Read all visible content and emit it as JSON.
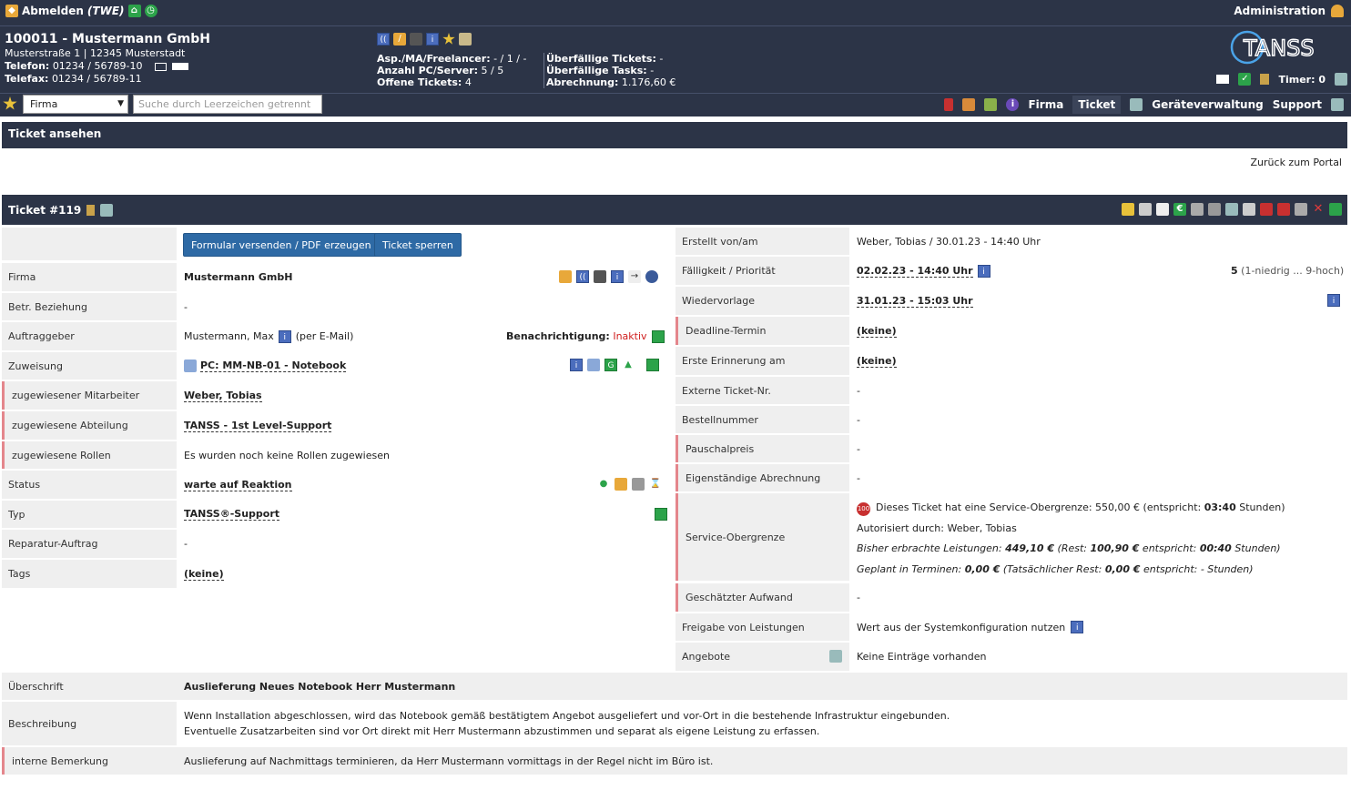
{
  "header": {
    "logout_label": "Abmelden",
    "user_code": "(TWE)",
    "admin_label": "Administration",
    "customer": {
      "title": "100011 - Mustermann GmbH",
      "address": "Musterstraße 1 | 12345 Musterstadt",
      "phone_label": "Telefon:",
      "phone": "01234 / 56789-10",
      "fax_label": "Telefax:",
      "fax": "01234 / 56789-11"
    },
    "stats_left": [
      {
        "label": "Asp./MA/Freelancer:",
        "value": "- / 1 / -"
      },
      {
        "label": "Anzahl PC/Server:",
        "value": "5 / 5"
      },
      {
        "label": "Offene Tickets:",
        "value": "4"
      }
    ],
    "stats_right": [
      {
        "label": "Überfällige Tickets:",
        "value": "-"
      },
      {
        "label": "Überfällige Tasks:",
        "value": "-"
      },
      {
        "label": "Abrechnung:",
        "value": "1.176,60 €"
      }
    ],
    "logo_text": "TANSS",
    "timer_label": "Timer: 0"
  },
  "toolbar": {
    "select_value": "Firma",
    "search_placeholder": "Suche durch Leerzeichen getrennt",
    "nav": [
      "Firma",
      "Ticket",
      "Geräteverwaltung",
      "Support"
    ]
  },
  "page": {
    "title": "Ticket ansehen",
    "back_link": "Zurück zum Portal"
  },
  "ticket": {
    "title": "Ticket #119",
    "buttons": {
      "send": "Formular versenden / PDF erzeugen",
      "lock": "Ticket sperren"
    },
    "left": {
      "firma": {
        "label": "Firma",
        "value": "Mustermann GmbH"
      },
      "relation": {
        "label": "Betr. Beziehung",
        "value": "-"
      },
      "client": {
        "label": "Auftraggeber",
        "value": "Mustermann, Max",
        "via": "(per E-Mail)",
        "notify_label": "Benachrichtigung:",
        "notify_value": "Inaktiv"
      },
      "assign": {
        "label": "Zuweisung",
        "value": "PC: MM-NB-01 - Notebook"
      },
      "employee": {
        "label": "zugewiesener Mitarbeiter",
        "value": "Weber, Tobias"
      },
      "department": {
        "label": "zugewiesene Abteilung",
        "value": "TANSS - 1st Level-Support"
      },
      "roles": {
        "label": "zugewiesene Rollen",
        "value": "Es wurden noch keine Rollen zugewiesen"
      },
      "status": {
        "label": "Status",
        "value": "warte auf Reaktion"
      },
      "type": {
        "label": "Typ",
        "value": "TANSS®-Support"
      },
      "repair": {
        "label": "Reparatur-Auftrag",
        "value": "-"
      },
      "tags": {
        "label": "Tags",
        "value": "(keine)"
      }
    },
    "right": {
      "created": {
        "label": "Erstellt von/am",
        "value": "Weber, Tobias / 30.01.23 - 14:40 Uhr"
      },
      "due": {
        "label": "Fälligkeit / Priorität",
        "value": "02.02.23 - 14:40 Uhr",
        "prio_value": "5",
        "prio_hint": "(1-niedrig ... 9-hoch)"
      },
      "resubmit": {
        "label": "Wiedervorlage",
        "value": "31.01.23 - 15:03 Uhr"
      },
      "deadline": {
        "label": "Deadline-Termin",
        "value": "(keine)"
      },
      "reminder": {
        "label": "Erste Erinnerung am",
        "value": "(keine)"
      },
      "ext_no": {
        "label": "Externe Ticket-Nr.",
        "value": "-"
      },
      "order_no": {
        "label": "Bestellnummer",
        "value": "-"
      },
      "flat": {
        "label": "Pauschalpreis",
        "value": "-"
      },
      "own_billing": {
        "label": "Eigenständige Abrechnung",
        "value": "-"
      },
      "service_cap": {
        "label": "Service-Obergrenze",
        "badge": "100",
        "line1a": "Dieses Ticket hat eine Service-Obergrenze: 550,00 € (entspricht:",
        "line1b": "03:40",
        "line1c": "Stunden)",
        "line2": "Autorisiert durch: Weber, Tobias",
        "line3a": "Bisher erbrachte Leistungen:",
        "line3b": "449,10 €",
        "line3c": "(Rest:",
        "line3d": "100,90 €",
        "line3e": "entspricht:",
        "line3f": "00:40",
        "line3g": "Stunden)",
        "line4a": "Geplant in Terminen:",
        "line4b": "0,00 €",
        "line4c": "(Tatsächlicher Rest:",
        "line4d": "0,00 €",
        "line4e": "entspricht: - Stunden)"
      },
      "effort": {
        "label": "Geschätzter Aufwand",
        "value": "-"
      },
      "release": {
        "label": "Freigabe von Leistungen",
        "value": "Wert aus der Systemkonfiguration nutzen"
      },
      "offers": {
        "label": "Angebote",
        "value": "Keine Einträge vorhanden"
      }
    },
    "bottom": {
      "heading": {
        "label": "Überschrift",
        "value": "Auslieferung Neues Notebook Herr Mustermann"
      },
      "description": {
        "label": "Beschreibung",
        "line1": "Wenn Installation abgeschlossen, wird das Notebook gemäß bestätigtem Angebot ausgeliefert und vor-Ort in die bestehende Infrastruktur eingebunden.",
        "line2": "Eventuelle Zusatzarbeiten sind vor Ort direkt mit Herr Mustermann abzustimmen und separat als eigene Leistung zu erfassen."
      },
      "internal": {
        "label": "interne Bemerkung",
        "value": "Auslieferung auf Nachmittags terminieren, da Herr Mustermann vormittags in der Regel nicht im Büro ist."
      }
    }
  },
  "colors": {
    "header_bg": "#2c3447",
    "label_bg": "#efefef",
    "button_bg": "#2e6aa5",
    "accent_red": "#e4868c",
    "inactive": "#d02020"
  }
}
